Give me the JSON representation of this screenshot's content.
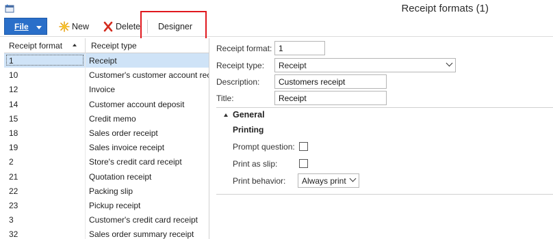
{
  "window": {
    "title": "Receipt formats (1)",
    "app_icon": "ax-app-icon"
  },
  "toolbar": {
    "file_label": "File",
    "new_label": "New",
    "delete_label": "Delete",
    "designer_label": "Designer"
  },
  "grid": {
    "columns": [
      "Receipt format",
      "Receipt type"
    ],
    "rows": [
      {
        "format": "1",
        "type": "Receipt",
        "selected": true
      },
      {
        "format": "10",
        "type": "Customer's customer account rec"
      },
      {
        "format": "12",
        "type": "Invoice"
      },
      {
        "format": "14",
        "type": "Customer account deposit"
      },
      {
        "format": "15",
        "type": "Credit memo"
      },
      {
        "format": "18",
        "type": "Sales order receipt"
      },
      {
        "format": "19",
        "type": "Sales invoice receipt"
      },
      {
        "format": "2",
        "type": "Store's credit card receipt"
      },
      {
        "format": "21",
        "type": "Quotation receipt"
      },
      {
        "format": "22",
        "type": "Packing slip"
      },
      {
        "format": "23",
        "type": "Pickup receipt"
      },
      {
        "format": "3",
        "type": "Customer's credit card receipt"
      },
      {
        "format": "32",
        "type": "Sales order summary receipt"
      }
    ]
  },
  "form": {
    "receipt_format_label": "Receipt format:",
    "receipt_format_value": "1",
    "receipt_type_label": "Receipt type:",
    "receipt_type_value": "Receipt",
    "description_label": "Description:",
    "description_value": "Customers receipt",
    "title_label": "Title:",
    "title_value": "Receipt"
  },
  "general": {
    "section_title": "General",
    "group_title": "Printing",
    "prompt_question_label": "Prompt question:",
    "prompt_question_checked": false,
    "print_as_slip_label": "Print as slip:",
    "print_as_slip_checked": false,
    "print_behavior_label": "Print behavior:",
    "print_behavior_value": "Always print"
  },
  "colors": {
    "file_button": "#2a6fc9",
    "selected_row": "#cfe3f7",
    "highlight_box": "#e0171d"
  }
}
